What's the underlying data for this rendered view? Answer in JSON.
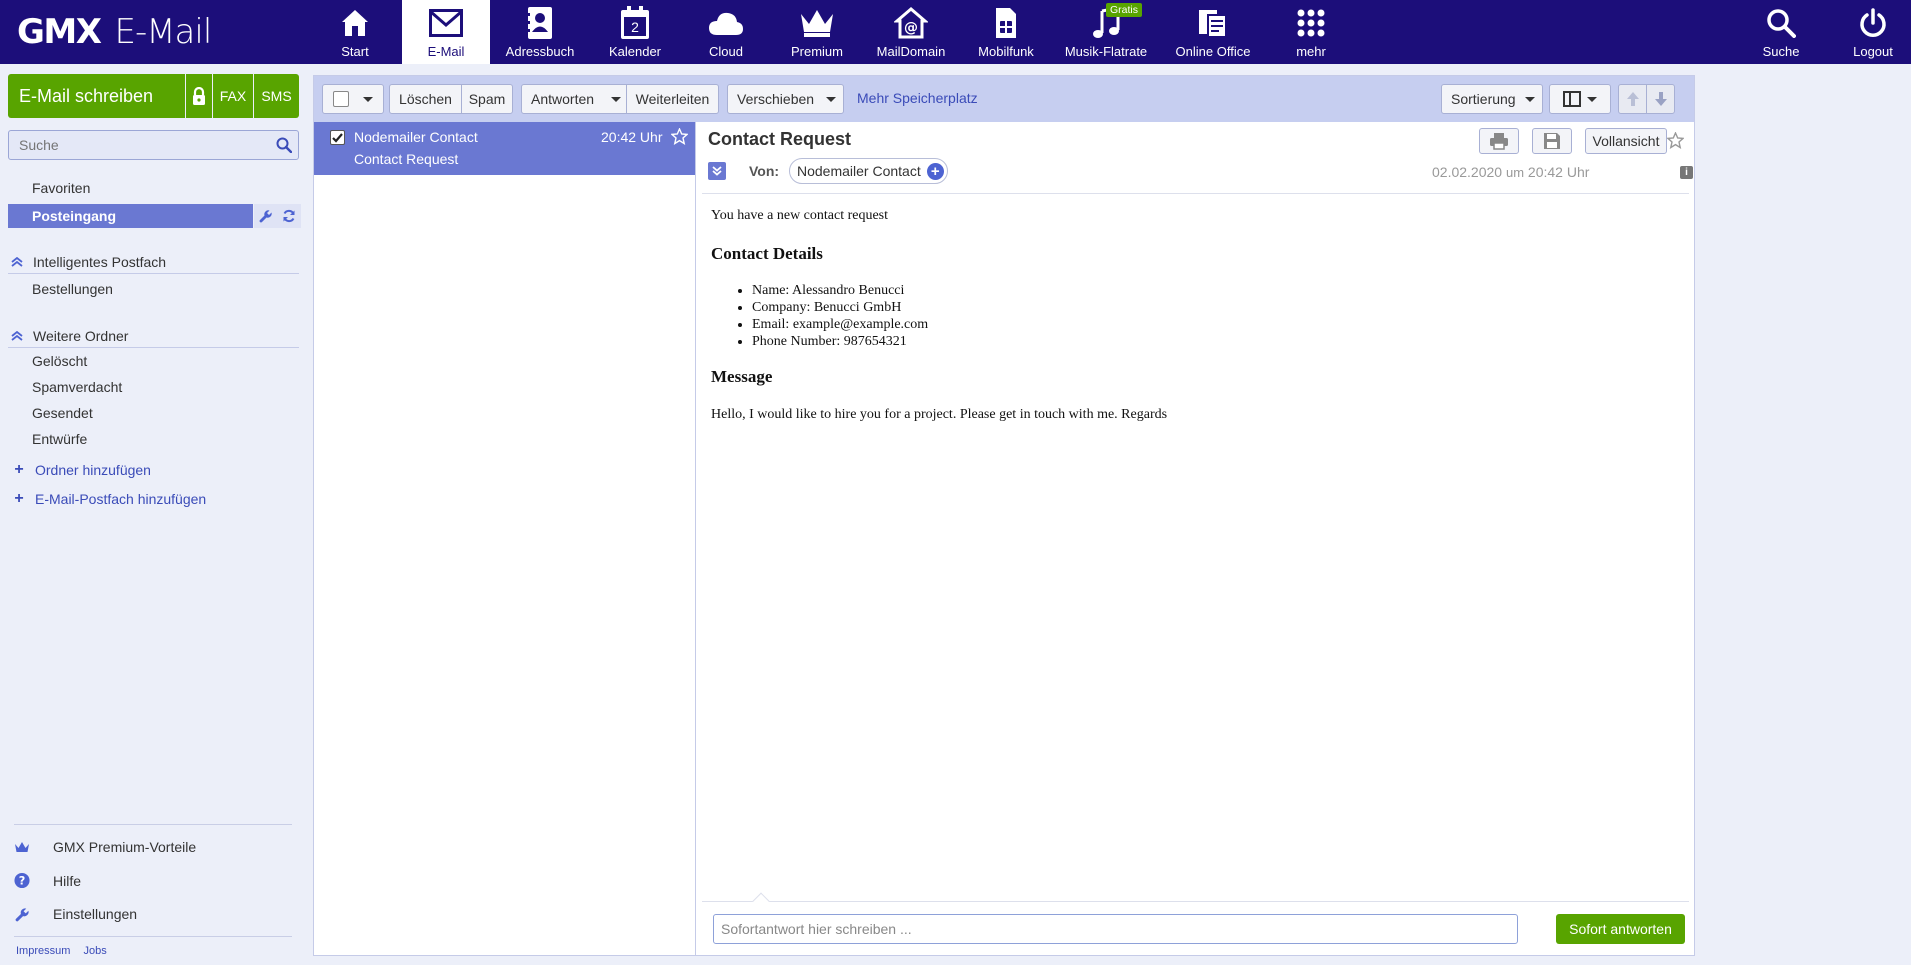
{
  "brand": {
    "logo_bold": "GMX",
    "logo_light": "E-Mail"
  },
  "nav": {
    "start": "Start",
    "email": "E-Mail",
    "adressbuch": "Adressbuch",
    "kalender": "Kalender",
    "kalender_day": "2",
    "cloud": "Cloud",
    "premium": "Premium",
    "maildomain": "MailDomain",
    "mobilfunk": "Mobilfunk",
    "musik": "Musik-Flatrate",
    "musik_badge": "Gratis",
    "office": "Online Office",
    "mehr": "mehr",
    "suche": "Suche",
    "logout": "Logout"
  },
  "sidebar": {
    "compose": "E-Mail schreiben",
    "fax": "FAX",
    "sms": "SMS",
    "search_placeholder": "Suche",
    "favoriten": "Favoriten",
    "posteingang": "Posteingang",
    "smart_section": "Intelligentes Postfach",
    "bestellungen": "Bestellungen",
    "more_section": "Weitere Ordner",
    "geloescht": "Gelöscht",
    "spam": "Spamverdacht",
    "gesendet": "Gesendet",
    "entwuerfe": "Entwürfe",
    "add_folder": "Ordner hinzufügen",
    "add_mailbox": "E-Mail-Postfach hinzufügen",
    "premium_vorteile": "GMX Premium-Vorteile",
    "hilfe": "Hilfe",
    "einstellungen": "Einstellungen",
    "impressum": "Impressum",
    "jobs": "Jobs"
  },
  "toolbar": {
    "loeschen": "Löschen",
    "spam": "Spam",
    "antworten": "Antworten",
    "weiterleiten": "Weiterleiten",
    "verschieben": "Verschieben",
    "speicher": "Mehr Speicherplatz",
    "sortierung": "Sortierung"
  },
  "message_list": [
    {
      "from": "Nodemailer Contact",
      "subject": "Contact Request",
      "time": "20:42 Uhr",
      "checked": true
    }
  ],
  "reader": {
    "subject": "Contact Request",
    "vollansicht": "Vollansicht",
    "von_label": "Von:",
    "sender": "Nodemailer Contact",
    "date": "02.02.2020",
    "date_um": "um",
    "time": "20:42 Uhr",
    "body": {
      "intro": "You have a new contact request",
      "details_heading": "Contact Details",
      "details": [
        "Name: Alessandro Benucci",
        "Company: Benucci GmbH",
        "Email: example@example.com",
        "Phone Number: 987654321"
      ],
      "message_heading": "Message",
      "message": "Hello, I would like to hire you for a project. Please get in touch with me. Regards"
    },
    "reply_placeholder": "Sofortantwort hier schreiben ...",
    "reply_button": "Sofort antworten"
  },
  "colors": {
    "topbar": "#1c0e7a",
    "accent_green": "#58a400",
    "selection": "#6a78d2",
    "sidebar_bg": "#eceff9",
    "link": "#3a4bb8"
  }
}
